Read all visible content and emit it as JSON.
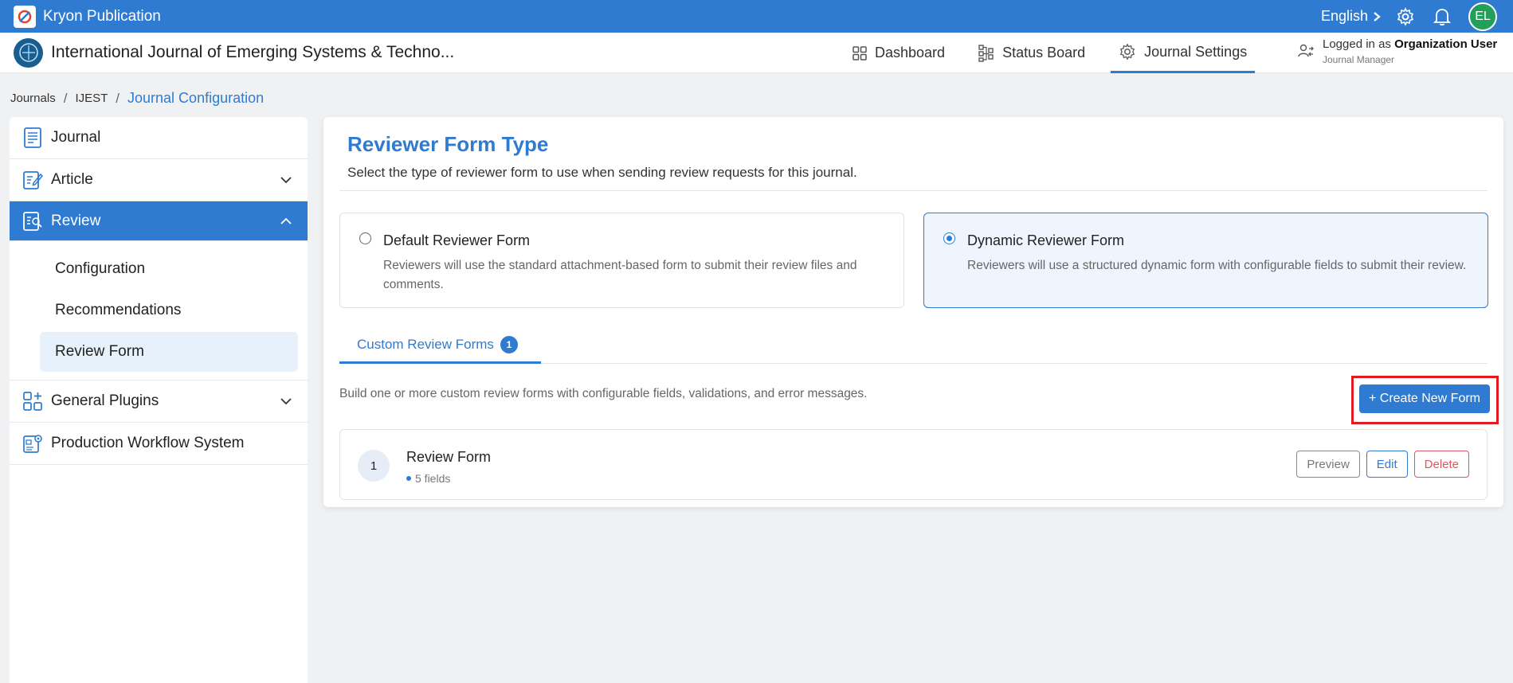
{
  "topbar": {
    "app_name": "Kryon Publication",
    "language": "English",
    "avatar_initials": "EL"
  },
  "header": {
    "journal_title": "International Journal of Emerging Systems & Techno...",
    "nav": [
      {
        "label": "Dashboard",
        "icon": "grid-icon"
      },
      {
        "label": "Status Board",
        "icon": "status-board-icon"
      },
      {
        "label": "Journal Settings",
        "icon": "gear-icon",
        "active": true
      }
    ],
    "user": {
      "prefix": "Logged in as ",
      "name": "Organization User",
      "role": "Journal Manager"
    }
  },
  "breadcrumb": {
    "items": [
      "Journals",
      "IJEST"
    ],
    "current": "Journal Configuration"
  },
  "sidebar": {
    "items": [
      {
        "label": "Journal"
      },
      {
        "label": "Article"
      },
      {
        "label": "Review",
        "active": true
      },
      {
        "label": "General Plugins"
      },
      {
        "label": "Production Workflow System"
      }
    ],
    "review_sub": [
      {
        "label": "Configuration"
      },
      {
        "label": "Recommendations"
      },
      {
        "label": "Review Form",
        "selected": true
      }
    ]
  },
  "main": {
    "title": "Reviewer Form Type",
    "subtitle": "Select the type of reviewer form to use when sending review requests for this journal.",
    "options": [
      {
        "title": "Default Reviewer Form",
        "description": "Reviewers will use the standard attachment-based form to submit their review files and comments.",
        "selected": false
      },
      {
        "title": "Dynamic Reviewer Form",
        "description": "Reviewers will use a structured dynamic form with configurable fields to submit their review.",
        "selected": true
      }
    ],
    "tab": {
      "label": "Custom Review Forms",
      "count": "1"
    },
    "build_text": "Build one or more custom review forms with configurable fields, validations, and error messages.",
    "create_button": "+ Create New Form",
    "forms": [
      {
        "number": "1",
        "name": "Review Form",
        "fields": "5 fields"
      }
    ],
    "actions": {
      "preview": "Preview",
      "edit": "Edit",
      "delete": "Delete"
    }
  },
  "colors": {
    "accent": "#2f7bd1",
    "highlight": "#e21b23",
    "danger": "#e05560"
  }
}
